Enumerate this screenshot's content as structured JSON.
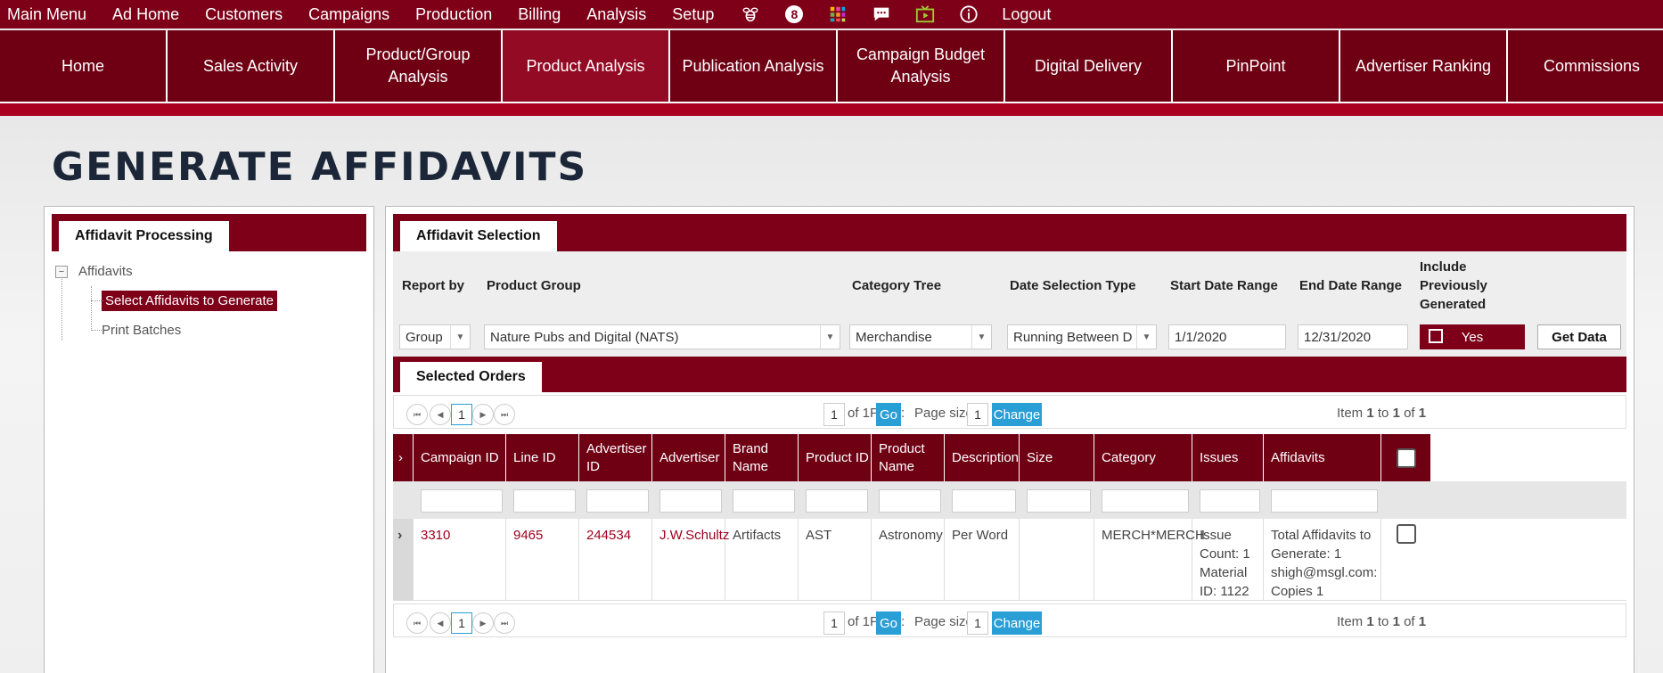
{
  "topmenu": {
    "items": [
      "Main Menu",
      "Ad Home",
      "Customers",
      "Campaigns",
      "Production",
      "Billing",
      "Analysis",
      "Setup"
    ],
    "badge": "8",
    "logout": "Logout",
    "icons": [
      "bee-icon",
      "notification-badge",
      "apps-grid-icon",
      "chat-icon",
      "video-icon",
      "info-icon"
    ]
  },
  "nav": {
    "tabs": [
      "Home",
      "Sales Activity",
      "Product/Group Analysis",
      "Product Analysis",
      "Publication Analysis",
      "Campaign Budget Analysis",
      "Digital Delivery",
      "PinPoint",
      "Advertiser Ranking",
      "Commissions"
    ],
    "active_index": 3
  },
  "page": {
    "title": "GENERATE AFFIDAVITS"
  },
  "left_panel": {
    "tab": "Affidavit Processing",
    "tree_root": "Affidavits",
    "tree_toggle": "−",
    "tree_items": [
      "Select Affidavits to Generate",
      "Print Batches"
    ]
  },
  "selection": {
    "tab": "Affidavit Selection",
    "labels": {
      "report_by": "Report by",
      "product_group": "Product Group",
      "category_tree": "Category Tree",
      "date_selection_type": "Date Selection Type",
      "start_date": "Start Date Range",
      "end_date": "End Date Range",
      "include_prev": "Include Previously Generated"
    },
    "values": {
      "report_by": "Group",
      "product_group": "Nature Pubs and Digital (NATS)",
      "category_tree": "Merchandise",
      "date_selection_type": "Running Between D",
      "start_date": "1/1/2020",
      "end_date": "12/31/2020",
      "include_prev": "Yes"
    },
    "get_data": "Get Data"
  },
  "orders": {
    "tab": "Selected Orders",
    "pager": {
      "page_label": "Page:",
      "page": "1",
      "of": "of 1",
      "go": "Go",
      "size_label": "Page size:",
      "size": "1",
      "change": "Change",
      "item_prefix": "Item",
      "item_from": "1",
      "item_to_word": "to",
      "item_to": "1",
      "item_of_word": "of",
      "item_total": "1"
    },
    "columns": [
      "Campaign ID",
      "Line ID",
      "Advertiser ID",
      "Advertiser",
      "Brand Name",
      "Product ID",
      "Product Name",
      "Description",
      "Size",
      "Category",
      "Issues",
      "Affidavits"
    ],
    "row": {
      "campaign_id": "3310",
      "line_id": "9465",
      "advertiser_id": "244534",
      "advertiser": "J.W.Schultz",
      "brand_name": "Artifacts",
      "product_id": "AST",
      "product_name": "Astronomy",
      "description": "Per Word",
      "size": "",
      "category": "MERCH*MERCH",
      "issues": "Issue Count: 1 Material ID: 1122",
      "affidavits": "Total Affidavits to Generate: 1 shigh@msgl.com: Copies 1"
    }
  }
}
